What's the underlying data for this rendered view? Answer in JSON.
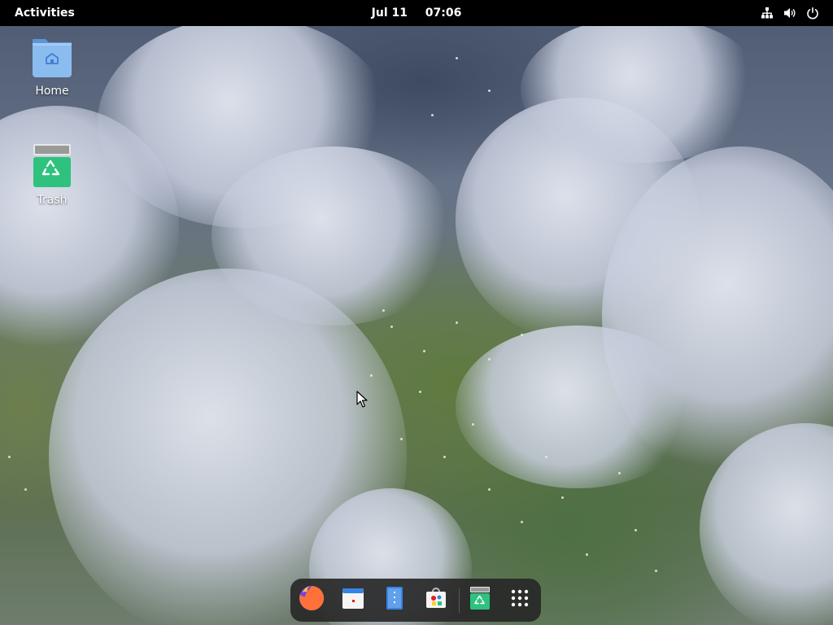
{
  "topbar": {
    "activities_label": "Activities",
    "date": "Jul 11",
    "time": "07:06",
    "status_icons": [
      "network-wired-icon",
      "volume-icon",
      "power-icon"
    ]
  },
  "desktop": {
    "icons": [
      {
        "label": "Home",
        "icon": "home-folder-icon"
      },
      {
        "label": "Trash",
        "icon": "trash-icon"
      }
    ]
  },
  "dock": {
    "apps": [
      {
        "name": "Firefox",
        "icon": "firefox-icon"
      },
      {
        "name": "Calendar",
        "icon": "calendar-icon"
      },
      {
        "name": "Text Editor",
        "icon": "text-editor-icon"
      },
      {
        "name": "Software",
        "icon": "software-store-icon"
      },
      {
        "name": "Trash",
        "icon": "trash-icon"
      },
      {
        "name": "Show Applications",
        "icon": "app-grid-icon"
      }
    ]
  },
  "colors": {
    "topbar_bg": "#000000",
    "dock_bg": "#282828",
    "folder_blue": "#8bbcf0",
    "trash_green": "#2ec27e",
    "calendar_blue": "#3584e4"
  }
}
